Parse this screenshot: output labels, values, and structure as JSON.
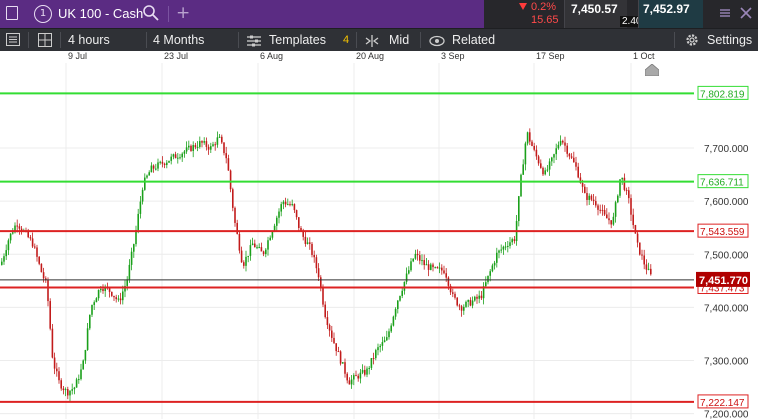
{
  "header": {
    "instrument_number": "1",
    "instrument_name": "UK 100 - Cash",
    "change_pct": "0.2%",
    "change_points": "15.65",
    "sell_price": "7,450.57",
    "spread": "2.40",
    "buy_price": "7,452.97",
    "accent_color": "#5b2c83"
  },
  "toolbar": {
    "interval_label": "4 hours",
    "range_label": "4 Months",
    "templates_label": "Templates",
    "templates_count": "4",
    "mid_label": "Mid",
    "related_label": "Related",
    "settings_label": "Settings"
  },
  "chart_data": {
    "type": "candlestick",
    "x_ticks": [
      "9 Jul",
      "23 Jul",
      "6 Aug",
      "20 Aug",
      "3 Sep",
      "17 Sep",
      "1 Oct"
    ],
    "y_ticks": [
      "7,700.000",
      "7,600.000",
      "7,500.000",
      "7,400.000",
      "7,300.000",
      "7,200.000"
    ],
    "ylim": [
      7190,
      7860
    ],
    "current_price": "7,451.770",
    "current_price_color": "#b00000",
    "levels": [
      {
        "label": "7,802.819",
        "value": 7802.819,
        "color": "#33dd33"
      },
      {
        "label": "7,636.711",
        "value": 7636.711,
        "color": "#33dd33"
      },
      {
        "label": "7,543.559",
        "value": 7543.559,
        "color": "#dd2222"
      },
      {
        "label": "7,437.473",
        "value": 7437.473,
        "color": "#dd2222"
      },
      {
        "label": "7,222.147",
        "value": 7222.147,
        "color": "#dd2222"
      }
    ],
    "price_path": [
      [
        0,
        7480
      ],
      [
        8,
        7530
      ],
      [
        16,
        7560
      ],
      [
        24,
        7540
      ],
      [
        32,
        7520
      ],
      [
        40,
        7470
      ],
      [
        46,
        7440
      ],
      [
        52,
        7300
      ],
      [
        58,
        7260
      ],
      [
        66,
        7240
      ],
      [
        74,
        7250
      ],
      [
        82,
        7290
      ],
      [
        90,
        7400
      ],
      [
        100,
        7440
      ],
      [
        110,
        7430
      ],
      [
        118,
        7410
      ],
      [
        126,
        7450
      ],
      [
        134,
        7530
      ],
      [
        142,
        7630
      ],
      [
        150,
        7660
      ],
      [
        160,
        7670
      ],
      [
        170,
        7680
      ],
      [
        180,
        7690
      ],
      [
        190,
        7700
      ],
      [
        200,
        7710
      ],
      [
        210,
        7700
      ],
      [
        218,
        7720
      ],
      [
        226,
        7680
      ],
      [
        234,
        7560
      ],
      [
        242,
        7480
      ],
      [
        252,
        7520
      ],
      [
        262,
        7500
      ],
      [
        272,
        7550
      ],
      [
        282,
        7600
      ],
      [
        292,
        7590
      ],
      [
        300,
        7540
      ],
      [
        310,
        7510
      ],
      [
        318,
        7460
      ],
      [
        324,
        7390
      ],
      [
        332,
        7340
      ],
      [
        340,
        7300
      ],
      [
        348,
        7260
      ],
      [
        356,
        7270
      ],
      [
        366,
        7280
      ],
      [
        376,
        7320
      ],
      [
        386,
        7340
      ],
      [
        396,
        7410
      ],
      [
        406,
        7460
      ],
      [
        414,
        7500
      ],
      [
        424,
        7480
      ],
      [
        434,
        7470
      ],
      [
        444,
        7470
      ],
      [
        452,
        7420
      ],
      [
        460,
        7400
      ],
      [
        470,
        7410
      ],
      [
        480,
        7420
      ],
      [
        488,
        7460
      ],
      [
        496,
        7500
      ],
      [
        506,
        7520
      ],
      [
        514,
        7530
      ],
      [
        520,
        7640
      ],
      [
        526,
        7730
      ],
      [
        534,
        7690
      ],
      [
        544,
        7650
      ],
      [
        552,
        7680
      ],
      [
        560,
        7720
      ],
      [
        568,
        7690
      ],
      [
        576,
        7660
      ],
      [
        584,
        7610
      ],
      [
        594,
        7600
      ],
      [
        604,
        7570
      ],
      [
        612,
        7560
      ],
      [
        620,
        7650
      ],
      [
        628,
        7600
      ],
      [
        636,
        7520
      ],
      [
        644,
        7480
      ],
      [
        652,
        7452
      ]
    ]
  }
}
